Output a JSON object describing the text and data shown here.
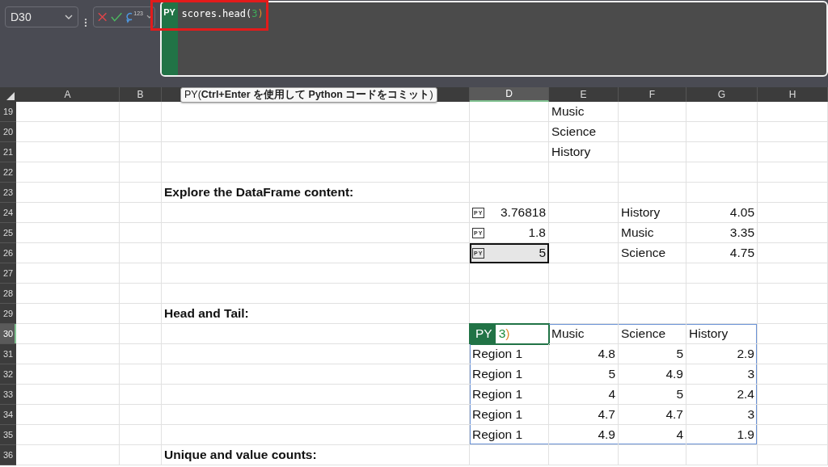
{
  "name_box": {
    "value": "D30"
  },
  "formula_bar": {
    "function_label": "123",
    "badge": "PY",
    "tokens": [
      {
        "text": "scores.head(",
        "kind": "code"
      },
      {
        "text": "3",
        "kind": "number"
      },
      {
        "text": ")",
        "kind": "paren"
      }
    ]
  },
  "tooltip": "PY(**Ctrl+Enter を使用して Python コードをコミット**)",
  "columns": [
    {
      "label": "A",
      "selected": false
    },
    {
      "label": "B",
      "selected": false
    },
    {
      "selected": false
    },
    {
      "label": "D",
      "selected": true
    },
    {
      "label": "E",
      "selected": false
    },
    {
      "label": "F",
      "selected": false
    },
    {
      "label": "G",
      "selected": false
    },
    {
      "label": "H",
      "selected": false
    }
  ],
  "rows": [
    {
      "number": "19",
      "selected": false,
      "cells": [
        {
          "kind": "empty"
        },
        {
          "kind": "empty"
        },
        {
          "kind": "empty"
        },
        {
          "kind": "empty"
        },
        {
          "kind": "text",
          "text": "Music",
          "selected": false,
          "highlighted": false
        },
        {
          "kind": "empty"
        },
        {
          "kind": "empty"
        },
        {
          "kind": "empty"
        }
      ]
    },
    {
      "number": "20",
      "selected": false,
      "cells": [
        {
          "kind": "empty"
        },
        {
          "kind": "empty"
        },
        {
          "kind": "empty"
        },
        {
          "kind": "empty"
        },
        {
          "kind": "text",
          "text": "Science",
          "selected": false,
          "highlighted": false
        },
        {
          "kind": "empty"
        },
        {
          "kind": "empty"
        },
        {
          "kind": "empty"
        }
      ]
    },
    {
      "number": "21",
      "selected": false,
      "cells": [
        {
          "kind": "empty"
        },
        {
          "kind": "empty"
        },
        {
          "kind": "empty"
        },
        {
          "kind": "empty"
        },
        {
          "kind": "text",
          "text": "History",
          "selected": false,
          "highlighted": false
        },
        {
          "kind": "empty"
        },
        {
          "kind": "empty"
        },
        {
          "kind": "empty"
        }
      ]
    },
    {
      "number": "22",
      "selected": false,
      "cells": [
        {
          "kind": "empty"
        },
        {
          "kind": "empty"
        },
        {
          "kind": "empty"
        },
        {
          "kind": "empty"
        },
        {
          "kind": "empty"
        },
        {
          "kind": "empty"
        },
        {
          "kind": "empty"
        },
        {
          "kind": "empty"
        }
      ]
    },
    {
      "number": "23",
      "selected": false,
      "cells": [
        {
          "kind": "empty"
        },
        {
          "kind": "empty"
        },
        {
          "kind": "heading",
          "text": "Explore the DataFrame content:",
          "selected": false,
          "highlighted": false
        },
        {
          "kind": "empty"
        },
        {
          "kind": "empty"
        },
        {
          "kind": "empty"
        },
        {
          "kind": "empty"
        },
        {
          "kind": "empty"
        }
      ]
    },
    {
      "number": "24",
      "selected": false,
      "cells": [
        {
          "kind": "empty"
        },
        {
          "kind": "empty"
        },
        {
          "kind": "empty"
        },
        {
          "kind": "python",
          "badge": "PY",
          "text": "3.76818",
          "selected": false,
          "highlighted": false
        },
        {
          "kind": "empty"
        },
        {
          "kind": "text",
          "text": "History",
          "selected": false,
          "highlighted": false
        },
        {
          "kind": "number",
          "text": "4.05",
          "selected": false,
          "highlighted": false
        },
        {
          "kind": "empty"
        }
      ]
    },
    {
      "number": "25",
      "selected": false,
      "cells": [
        {
          "kind": "empty"
        },
        {
          "kind": "empty"
        },
        {
          "kind": "empty"
        },
        {
          "kind": "python",
          "badge": "PY",
          "text": "1.8",
          "selected": false,
          "highlighted": false
        },
        {
          "kind": "empty"
        },
        {
          "kind": "text",
          "text": "Music",
          "selected": false,
          "highlighted": false
        },
        {
          "kind": "number",
          "text": "3.35",
          "selected": false,
          "highlighted": false
        },
        {
          "kind": "empty"
        }
      ]
    },
    {
      "number": "26",
      "selected": false,
      "cells": [
        {
          "kind": "empty"
        },
        {
          "kind": "empty"
        },
        {
          "kind": "empty"
        },
        {
          "kind": "python",
          "badge": "PY",
          "text": "5",
          "selected": true,
          "highlighted": false
        },
        {
          "kind": "empty"
        },
        {
          "kind": "text",
          "text": "Science",
          "selected": false,
          "highlighted": false
        },
        {
          "kind": "number",
          "text": "4.75",
          "selected": false,
          "highlighted": false
        },
        {
          "kind": "empty"
        }
      ]
    },
    {
      "number": "27",
      "selected": false,
      "cells": [
        {
          "kind": "empty"
        },
        {
          "kind": "empty"
        },
        {
          "kind": "empty"
        },
        {
          "kind": "empty"
        },
        {
          "kind": "empty"
        },
        {
          "kind": "empty"
        },
        {
          "kind": "empty"
        },
        {
          "kind": "empty"
        }
      ]
    },
    {
      "number": "28",
      "selected": false,
      "cells": [
        {
          "kind": "empty"
        },
        {
          "kind": "empty"
        },
        {
          "kind": "empty"
        },
        {
          "kind": "empty"
        },
        {
          "kind": "empty"
        },
        {
          "kind": "empty"
        },
        {
          "kind": "empty"
        },
        {
          "kind": "empty"
        }
      ]
    },
    {
      "number": "29",
      "selected": false,
      "cells": [
        {
          "kind": "empty"
        },
        {
          "kind": "empty"
        },
        {
          "kind": "heading",
          "text": "Head and Tail:",
          "selected": false,
          "highlighted": false
        },
        {
          "kind": "empty"
        },
        {
          "kind": "empty"
        },
        {
          "kind": "empty"
        },
        {
          "kind": "empty"
        },
        {
          "kind": "empty"
        }
      ]
    },
    {
      "number": "30",
      "selected": true,
      "cells": [
        {
          "kind": "empty"
        },
        {
          "kind": "empty"
        },
        {
          "kind": "empty"
        },
        {
          "kind": "editing",
          "badge": "PY",
          "tokens": [
            {
              "text": "3",
              "kind": "number"
            },
            {
              "text": ")",
              "kind": "paren"
            }
          ],
          "selected": false,
          "highlighted": true
        },
        {
          "kind": "text",
          "text": "Music",
          "selected": false,
          "highlighted": true
        },
        {
          "kind": "text",
          "text": "Science",
          "selected": false,
          "highlighted": true
        },
        {
          "kind": "text",
          "text": "History",
          "selected": false,
          "highlighted": true
        },
        {
          "kind": "empty"
        }
      ]
    },
    {
      "number": "31",
      "selected": false,
      "cells": [
        {
          "kind": "empty"
        },
        {
          "kind": "empty"
        },
        {
          "kind": "empty"
        },
        {
          "kind": "text",
          "text": "Region 1",
          "selected": false,
          "highlighted": true
        },
        {
          "kind": "number",
          "text": "4.8",
          "selected": false,
          "highlighted": true
        },
        {
          "kind": "number",
          "text": "5",
          "selected": false,
          "highlighted": true
        },
        {
          "kind": "number",
          "text": "2.9",
          "selected": false,
          "highlighted": true
        },
        {
          "kind": "empty"
        }
      ]
    },
    {
      "number": "32",
      "selected": false,
      "cells": [
        {
          "kind": "empty"
        },
        {
          "kind": "empty"
        },
        {
          "kind": "empty"
        },
        {
          "kind": "text",
          "text": "Region 1",
          "selected": false,
          "highlighted": true
        },
        {
          "kind": "number",
          "text": "5",
          "selected": false,
          "highlighted": true
        },
        {
          "kind": "number",
          "text": "4.9",
          "selected": false,
          "highlighted": true
        },
        {
          "kind": "number",
          "text": "3",
          "selected": false,
          "highlighted": true
        },
        {
          "kind": "empty"
        }
      ]
    },
    {
      "number": "33",
      "selected": false,
      "cells": [
        {
          "kind": "empty"
        },
        {
          "kind": "empty"
        },
        {
          "kind": "empty"
        },
        {
          "kind": "text",
          "text": "Region 1",
          "selected": false,
          "highlighted": true
        },
        {
          "kind": "number",
          "text": "4",
          "selected": false,
          "highlighted": true
        },
        {
          "kind": "number",
          "text": "5",
          "selected": false,
          "highlighted": true
        },
        {
          "kind": "number",
          "text": "2.4",
          "selected": false,
          "highlighted": true
        },
        {
          "kind": "empty"
        }
      ]
    },
    {
      "number": "34",
      "selected": false,
      "cells": [
        {
          "kind": "empty"
        },
        {
          "kind": "empty"
        },
        {
          "kind": "empty"
        },
        {
          "kind": "text",
          "text": "Region 1",
          "selected": false,
          "highlighted": true
        },
        {
          "kind": "number",
          "text": "4.7",
          "selected": false,
          "highlighted": true
        },
        {
          "kind": "number",
          "text": "4.7",
          "selected": false,
          "highlighted": true
        },
        {
          "kind": "number",
          "text": "3",
          "selected": false,
          "highlighted": true
        },
        {
          "kind": "empty"
        }
      ]
    },
    {
      "number": "35",
      "selected": false,
      "cells": [
        {
          "kind": "empty"
        },
        {
          "kind": "empty"
        },
        {
          "kind": "empty"
        },
        {
          "kind": "text",
          "text": "Region 1",
          "selected": false,
          "highlighted": true
        },
        {
          "kind": "number",
          "text": "4.9",
          "selected": false,
          "highlighted": true
        },
        {
          "kind": "number",
          "text": "4",
          "selected": false,
          "highlighted": true
        },
        {
          "kind": "number",
          "text": "1.9",
          "selected": false,
          "highlighted": true
        },
        {
          "kind": "empty"
        }
      ]
    },
    {
      "number": "36",
      "selected": false,
      "cells": [
        {
          "kind": "empty"
        },
        {
          "kind": "empty"
        },
        {
          "kind": "heading",
          "text": "Unique and value counts:",
          "selected": false,
          "highlighted": false
        },
        {
          "kind": "empty"
        },
        {
          "kind": "empty"
        },
        {
          "kind": "empty"
        },
        {
          "kind": "empty"
        },
        {
          "kind": "empty"
        }
      ]
    }
  ]
}
